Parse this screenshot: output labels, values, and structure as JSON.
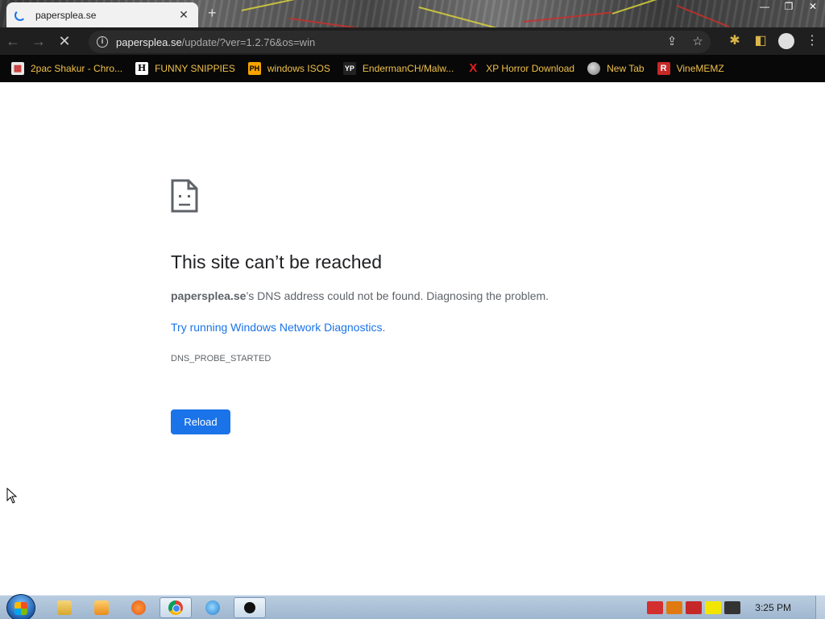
{
  "tab": {
    "title": "papersplea.se",
    "close_glyph": "✕",
    "newtab_glyph": "+"
  },
  "window_controls": {
    "minimize": "—",
    "maximize": "❐",
    "close": "✕"
  },
  "toolbar": {
    "back_glyph": "←",
    "forward_glyph": "→",
    "stop_glyph": "✕",
    "url_host": "papersplea.se",
    "url_path": "/update/?ver=1.2.76&os=win",
    "info_glyph": "i",
    "share_glyph": "⇪",
    "star_glyph": "☆",
    "puzzle_glyph": "✱",
    "sidepanel_glyph": "◧",
    "menu_glyph": "⋮"
  },
  "bookmarks": [
    {
      "label": "2pac Shakur - Chro...",
      "icon": "store-icon",
      "glyph": "▦"
    },
    {
      "label": "FUNNY SNIPPIES",
      "icon": "h-icon",
      "glyph": "H"
    },
    {
      "label": "windows ISOS",
      "icon": "ph-icon",
      "glyph": "PH"
    },
    {
      "label": "EndermanCH/Malw...",
      "icon": "yp-icon",
      "glyph": "YP"
    },
    {
      "label": "XP Horror Download",
      "icon": "x-icon",
      "glyph": "X"
    },
    {
      "label": "New Tab",
      "icon": "globe-icon",
      "glyph": ""
    },
    {
      "label": "VineMEMZ",
      "icon": "r-icon",
      "glyph": "R"
    }
  ],
  "error": {
    "title": "This site can’t be reached",
    "host": "papersplea.se",
    "desc_rest": "’s DNS address could not be found. Diagnosing the problem.",
    "link": "Try running Windows Network Diagnostics",
    "link_suffix": ".",
    "code": "DNS_PROBE_STARTED",
    "reload_label": "Reload"
  },
  "taskbar": {
    "clock": "3:25 PM",
    "apps": [
      "folder-icon",
      "media-icon",
      "paint-icon",
      "chrome-icon",
      "ie-icon",
      "rec-icon"
    ],
    "tray_colors": [
      "#d32f2f",
      "#e07a10",
      "#c62828",
      "#f2e600",
      "#333333"
    ]
  }
}
